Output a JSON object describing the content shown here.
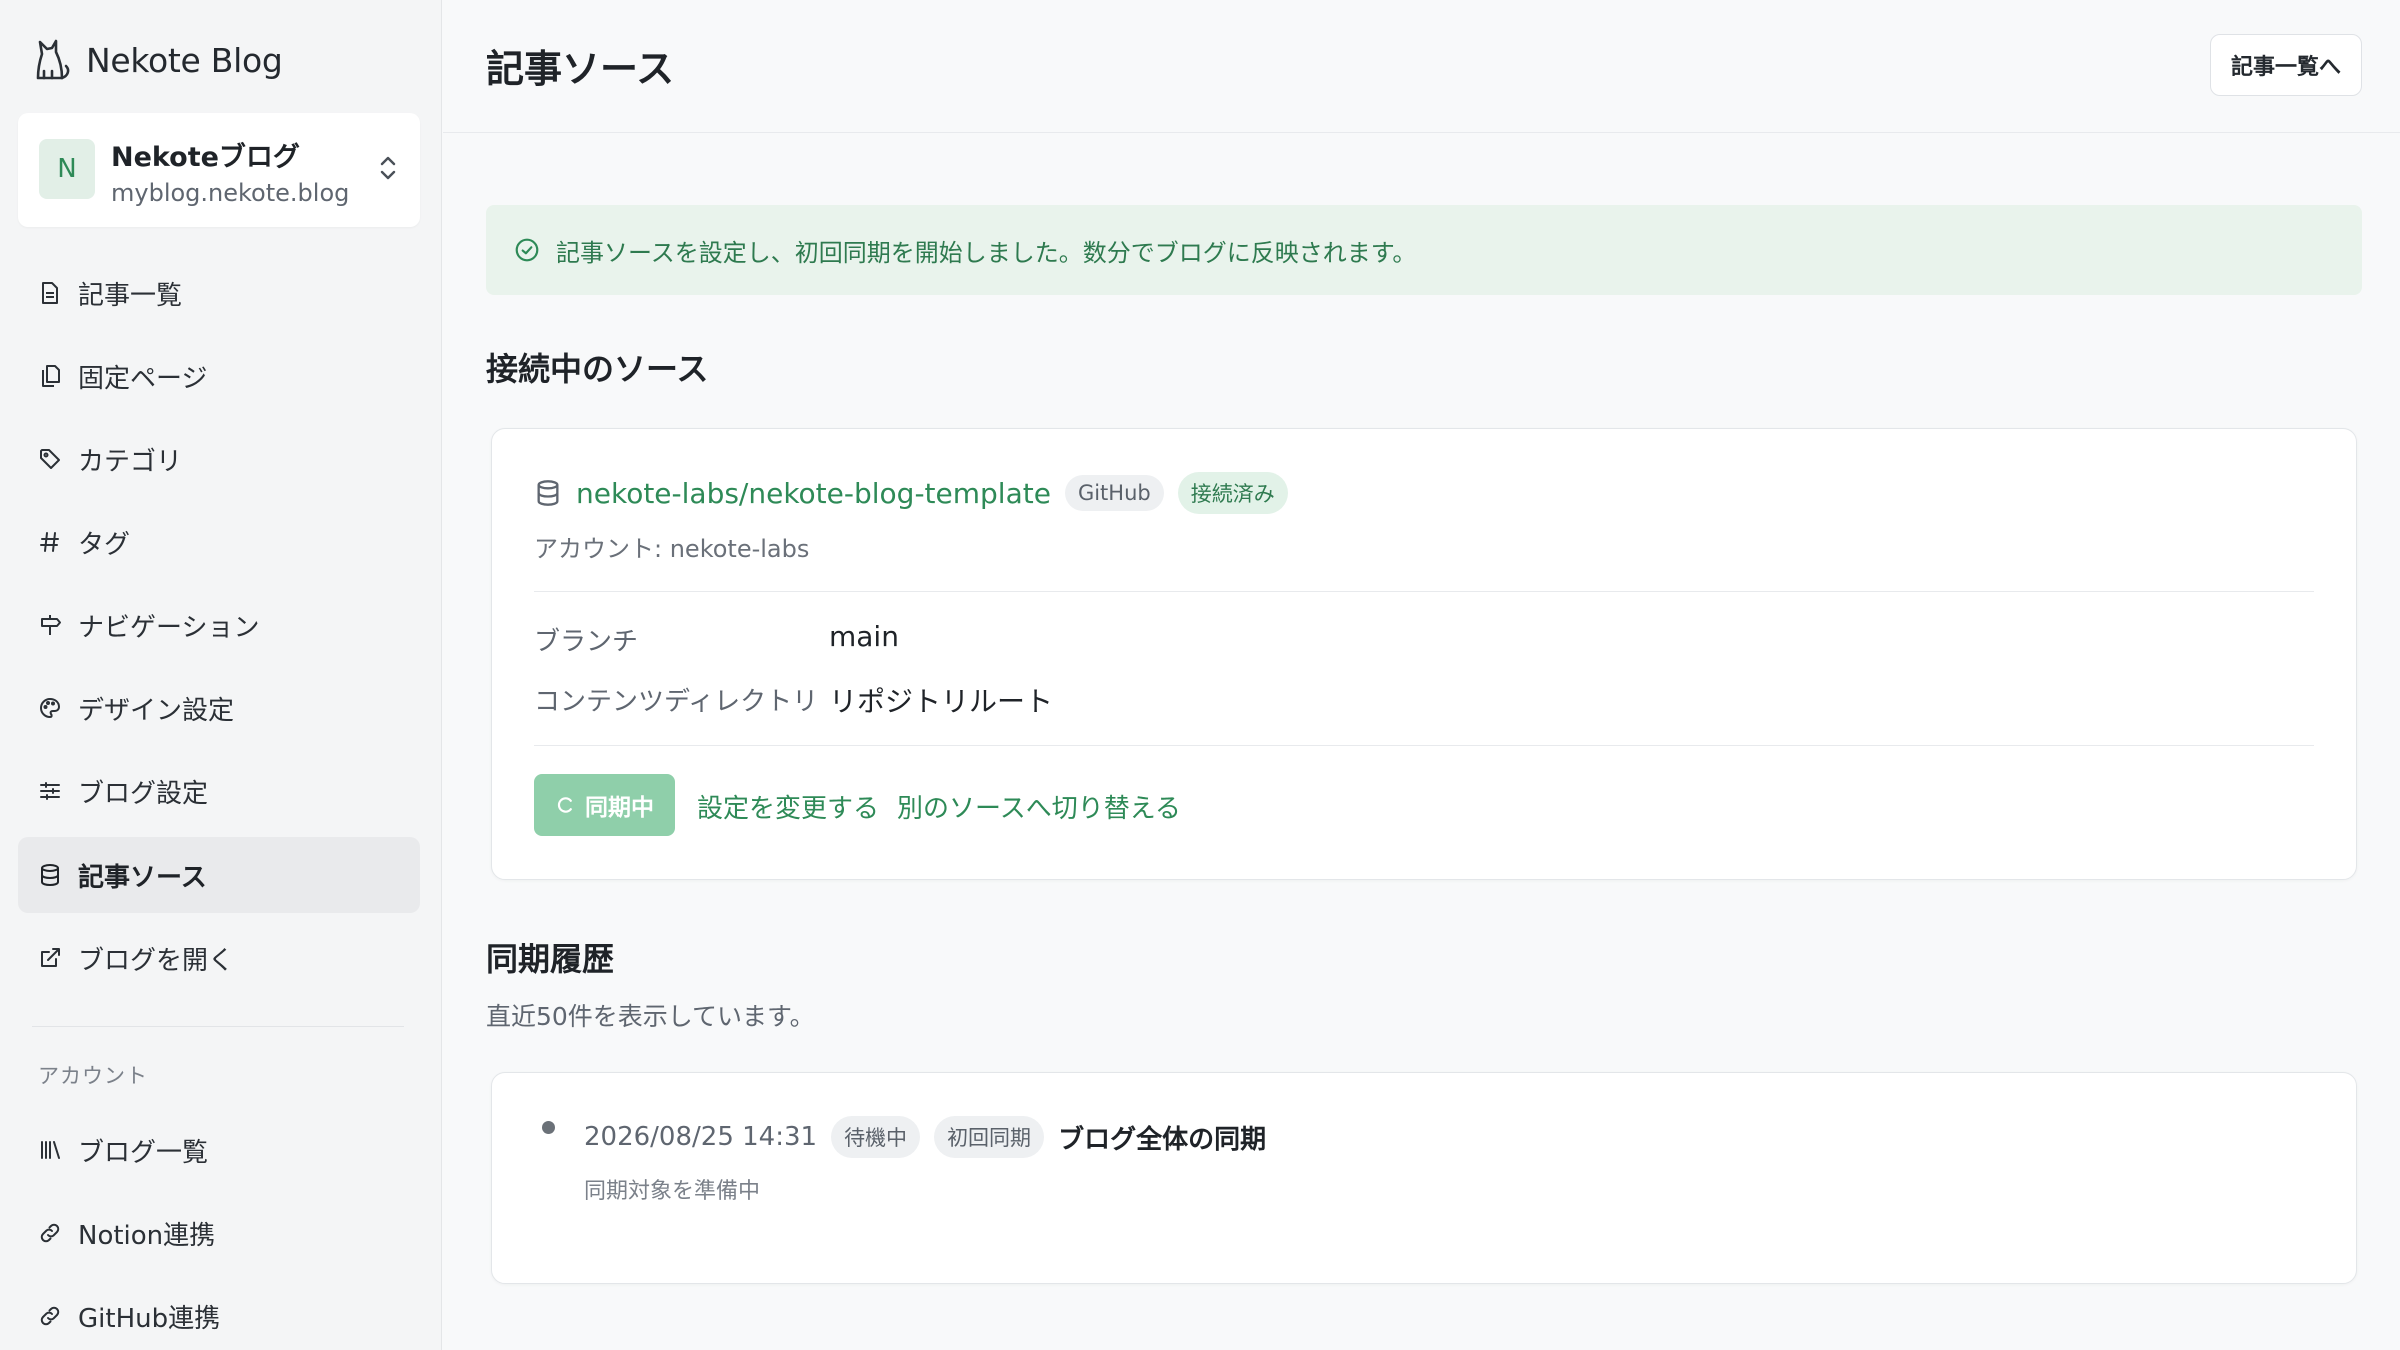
{
  "app": {
    "name": "Nekote Blog"
  },
  "blog_switcher": {
    "avatar_letter": "N",
    "name": "Nekoteブログ",
    "domain": "myblog.nekote.blog"
  },
  "sidebar": {
    "items": [
      {
        "label": "記事一覧",
        "icon": "document-icon"
      },
      {
        "label": "固定ページ",
        "icon": "pages-icon"
      },
      {
        "label": "カテゴリ",
        "icon": "tag-icon"
      },
      {
        "label": "タグ",
        "icon": "hash-icon"
      },
      {
        "label": "ナビゲーション",
        "icon": "signpost-icon"
      },
      {
        "label": "デザイン設定",
        "icon": "palette-icon"
      },
      {
        "label": "ブログ設定",
        "icon": "sliders-icon"
      },
      {
        "label": "記事ソース",
        "icon": "database-icon",
        "active": true
      },
      {
        "label": "ブログを開く",
        "icon": "external-link-icon"
      }
    ],
    "account_section": "アカウント",
    "account_items": [
      {
        "label": "ブログ一覧",
        "icon": "library-icon"
      },
      {
        "label": "Notion連携",
        "icon": "link-icon"
      },
      {
        "label": "GitHub連携",
        "icon": "link-icon"
      }
    ]
  },
  "header": {
    "title": "記事ソース",
    "back_button": "記事一覧へ"
  },
  "notice": {
    "text": "記事ソースを設定し、初回同期を開始しました。数分でブログに反映されます。"
  },
  "connected": {
    "heading": "接続中のソース",
    "repo": "nekote-labs/nekote-blog-template",
    "provider_badge": "GitHub",
    "status_badge": "接続済み",
    "account_line": "アカウント: nekote-labs",
    "fields": [
      {
        "key": "ブランチ",
        "value": "main"
      },
      {
        "key": "コンテンツディレクトリ",
        "value": "リポジトリルート"
      }
    ],
    "sync_button": "同期中",
    "change_settings": "設定を変更する",
    "switch_source": "別のソースへ切り替える"
  },
  "history": {
    "heading": "同期履歴",
    "subtext": "直近50件を表示しています。",
    "entries": [
      {
        "datetime": "2026/08/25 14:31",
        "status": "待機中",
        "type": "初回同期",
        "title": "ブログ全体の同期",
        "detail": "同期対象を準備中"
      }
    ]
  },
  "colors": {
    "accent": "#2e8a57",
    "notice_bg": "#e9f3ec",
    "sync_button_bg": "#8fcfaa"
  }
}
